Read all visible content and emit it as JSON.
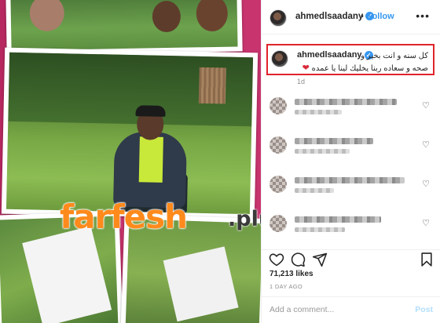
{
  "post": {
    "username": "ahmedlsaadany",
    "verified_icon": "verified-badge-icon",
    "follow_label": "Follow",
    "separator": "•",
    "more_label": "•••"
  },
  "caption": {
    "username": "ahmedlsaadany",
    "line1": "كل سنه و انت بخير و",
    "line2": "صحه و سعاده ربنا يخليك لينا يا عمده",
    "heart": "❤",
    "time": "1d"
  },
  "comments": [
    {
      "name_blur": "",
      "text_blur": ""
    },
    {
      "name_blur": "",
      "text_blur": ""
    },
    {
      "name_blur": "",
      "text_blur": ""
    },
    {
      "name_blur": "",
      "text_blur": ""
    }
  ],
  "actions": {
    "like_icon": "heart-outline-icon",
    "comment_icon": "comment-bubble-icon",
    "share_icon": "send-paper-plane-icon",
    "save_icon": "bookmark-icon"
  },
  "likes_text": "71,213 likes",
  "date_text": "1 DAY AGO",
  "comment_box": {
    "placeholder": "Add a comment...",
    "post_label": "Post"
  },
  "watermark": {
    "main": "farfesh",
    "sub": ".plus.com"
  },
  "colors": {
    "accent_blue": "#3897f0",
    "highlight_red": "#e0232b",
    "collage_pink": "#c8346e",
    "watermark_orange": "#ff8a1c"
  }
}
